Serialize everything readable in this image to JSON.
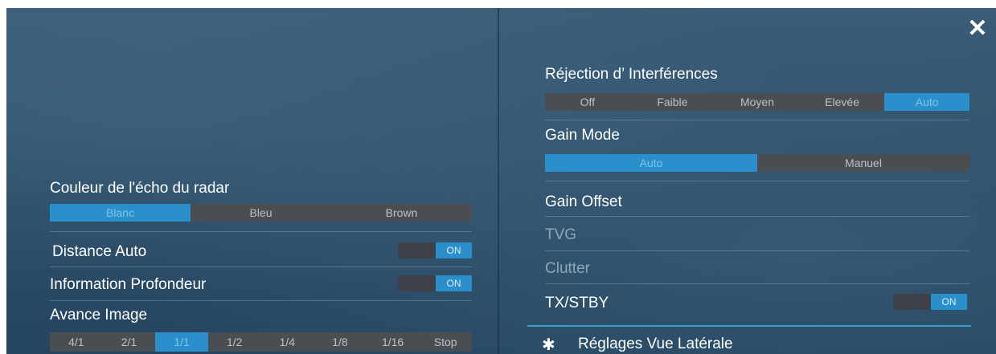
{
  "close_icon": "close-icon",
  "left": {
    "echo_color": {
      "label": "Couleur de l'écho du radar",
      "options": [
        "Blanc",
        "Bleu",
        "Brown"
      ],
      "selected": "Blanc"
    },
    "auto_range": {
      "label": "Distance Auto",
      "state": "ON"
    },
    "depth_info": {
      "label": "Information Profondeur",
      "state": "ON"
    },
    "image_advance": {
      "label": "Avance Image",
      "options": [
        "4/1",
        "2/1",
        "1/1",
        "1/2",
        "1/4",
        "1/8",
        "1/16",
        "Stop"
      ],
      "selected": "1/1"
    }
  },
  "right": {
    "interference": {
      "label": "Réjection d’ Interférences",
      "options": [
        "Off",
        "Faible",
        "Moyen",
        "Elevée",
        "Auto"
      ],
      "selected": "Auto"
    },
    "gain_mode": {
      "label": "Gain Mode",
      "options": [
        "Auto",
        "Manuel"
      ],
      "selected": "Auto"
    },
    "gain_offset": {
      "label": "Gain Offset"
    },
    "tvg": {
      "label": "TVG"
    },
    "clutter": {
      "label": "Clutter"
    },
    "tx_stby": {
      "label": "TX/STBY",
      "state": "ON"
    },
    "side_view": {
      "label": "Réglages Vue Latérale",
      "icon": "gear-icon"
    }
  },
  "colors": {
    "selected": "#2a8fca",
    "unselected": "#4a4e53",
    "background": "#2e5069"
  }
}
